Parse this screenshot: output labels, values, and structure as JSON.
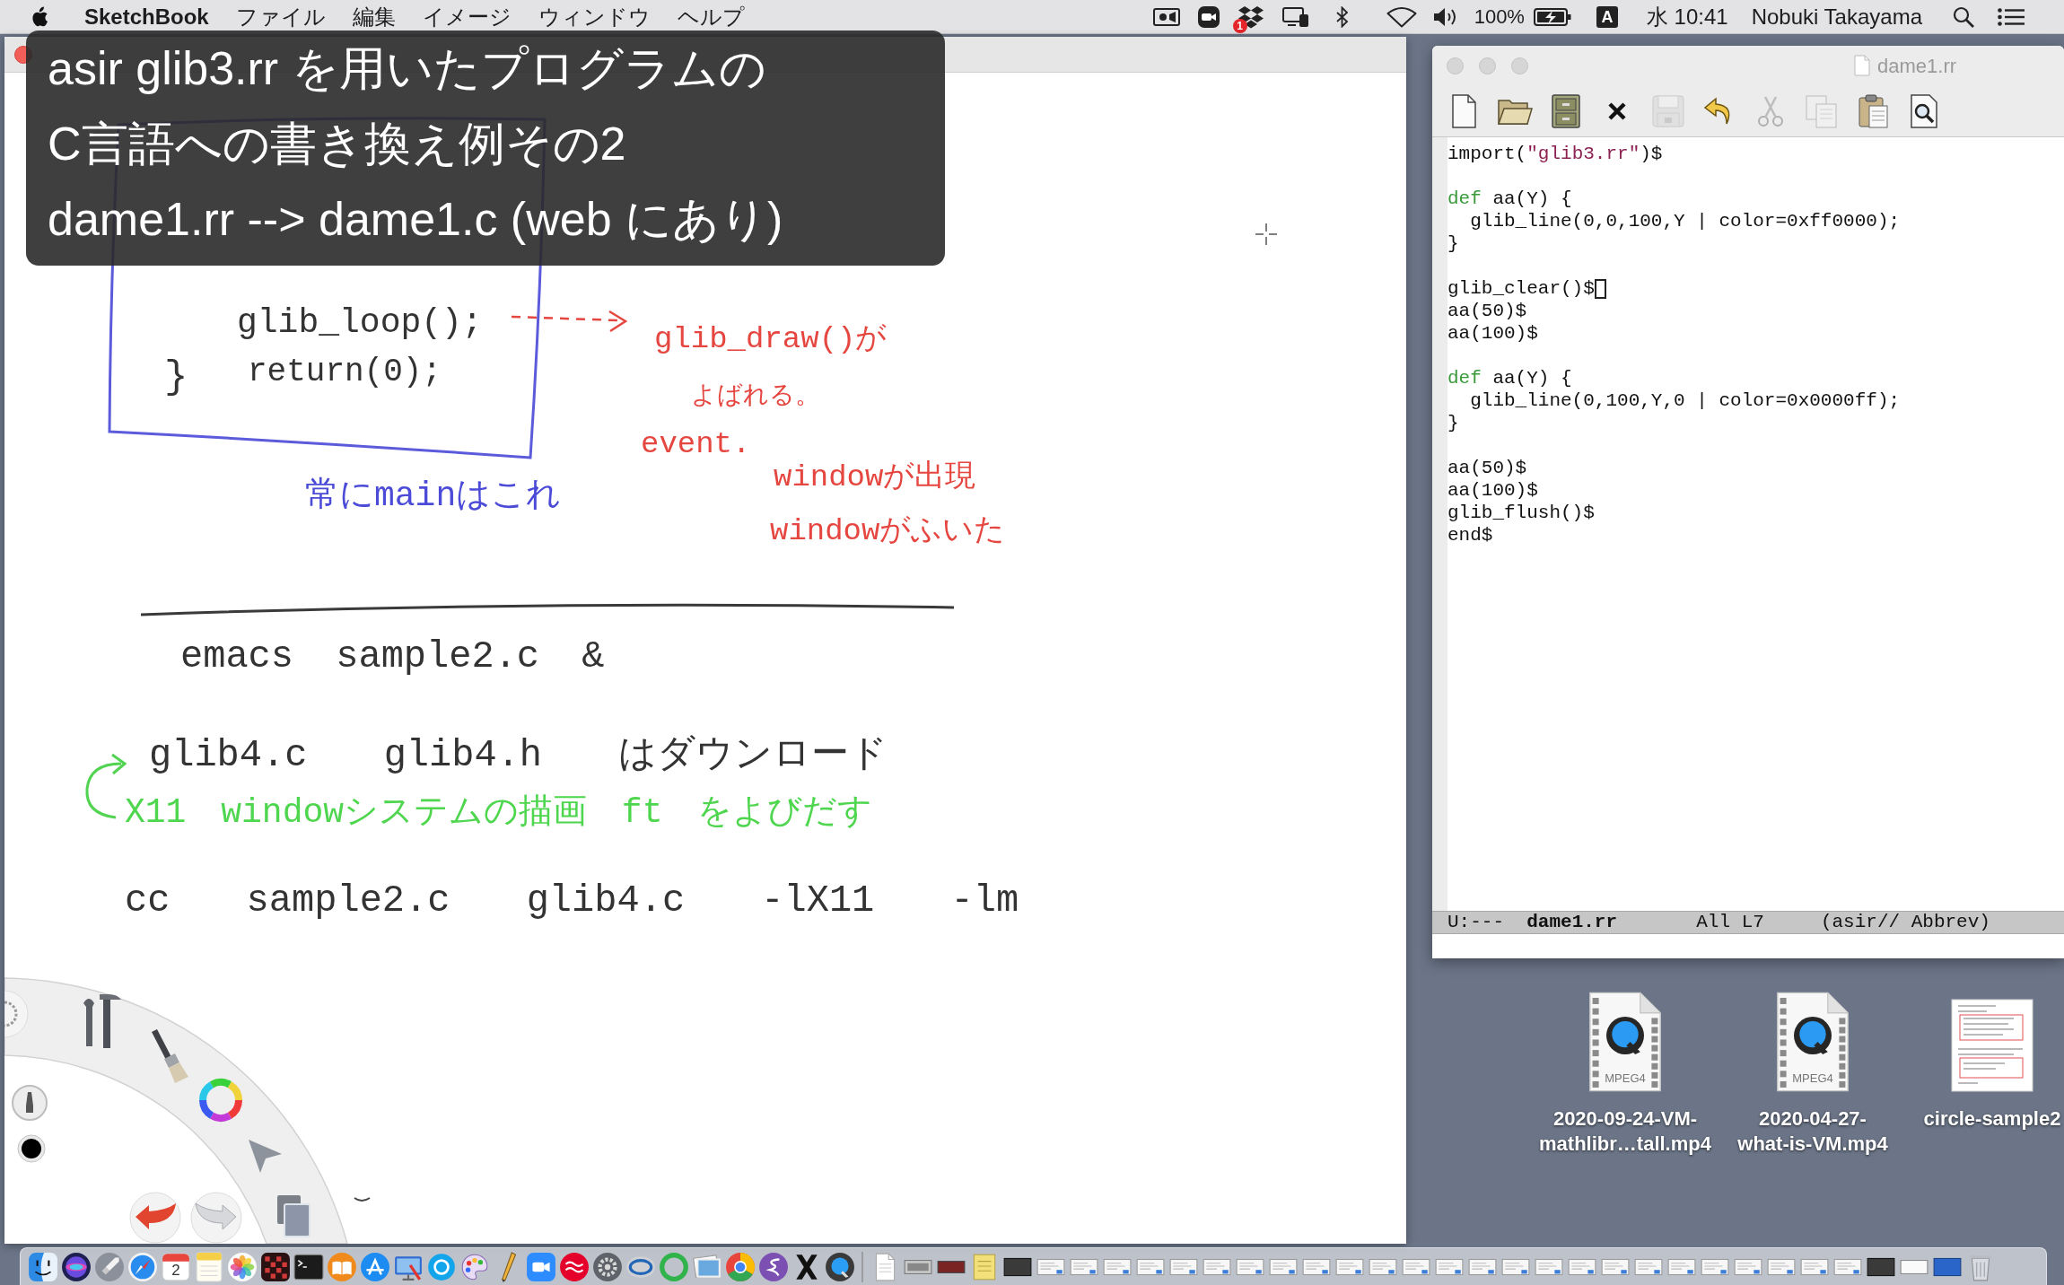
{
  "menu_bar": {
    "app_name": "SketchBook",
    "menus": [
      "ファイル",
      "編集",
      "イメージ",
      "ウィンドウ",
      "ヘルプ"
    ],
    "notification_badge": "1",
    "battery": "100%",
    "input_source": "A",
    "clock": "水 10:41",
    "user": "Nobuki Takayama"
  },
  "caption": {
    "lines": [
      "asir glib3.rr を用いたプログラムの",
      "C言語への書き換え例その2",
      "dame1.rr --> dame1.c (web にあり)"
    ]
  },
  "canvas": {
    "notes": [
      {
        "text": "glib_loop();",
        "color": "#333333"
      },
      {
        "text": "}",
        "color": "#333333"
      },
      {
        "text": "return(0);",
        "color": "#333333"
      },
      {
        "text": "glib_draw()が",
        "color": "#e5463f"
      },
      {
        "text": "よばれる。",
        "color": "#e5463f"
      },
      {
        "text": "event.",
        "color": "#e5463f"
      },
      {
        "text": "windowが出現",
        "color": "#e5463f"
      },
      {
        "text": "windowがふいた",
        "color": "#e5463f"
      },
      {
        "text": "常にmainはこれ",
        "color": "#4b4bd8"
      },
      {
        "text": "emacs sample2.c &",
        "color": "#333333"
      },
      {
        "text": "glib4.c glib4.h はダウンロード",
        "color": "#333333"
      },
      {
        "text": "X11 windowシステムの描画 ft をよびだす",
        "color": "#4fd64f"
      },
      {
        "text": "cc sample2.c glib4.c -lX11 -lm",
        "color": "#333333"
      }
    ]
  },
  "editor": {
    "title": "dame1.rr",
    "toolbar": [
      {
        "disabled": false
      },
      {
        "disabled": false
      },
      {
        "disabled": false
      },
      {
        "disabled": false
      },
      {
        "disabled": true
      },
      {
        "disabled": false
      },
      {
        "disabled": true
      },
      {
        "disabled": true
      },
      {
        "disabled": false
      },
      {
        "disabled": false
      }
    ],
    "blocks": [
      [
        {
          "tokens": [
            {
              "text": "import(",
              "kind": "plain"
            },
            {
              "text": "\"glib3.rr\"",
              "kind": "string"
            },
            {
              "text": ")$",
              "kind": "plain"
            }
          ],
          "cursor": false
        }
      ],
      [
        {
          "tokens": [
            {
              "text": "def",
              "kind": "keyword"
            },
            {
              "text": " aa(Y) {",
              "kind": "plain"
            }
          ],
          "cursor": false
        },
        {
          "tokens": [
            {
              "text": "  glib_line(0,0,100,Y | color=0xff0000);",
              "kind": "plain"
            }
          ],
          "cursor": false
        },
        {
          "tokens": [
            {
              "text": "}",
              "kind": "plain"
            }
          ],
          "cursor": false
        }
      ],
      [
        {
          "tokens": [
            {
              "text": "glib_clear()$",
              "kind": "plain"
            }
          ],
          "cursor": true
        },
        {
          "tokens": [
            {
              "text": "aa(50)$",
              "kind": "plain"
            }
          ],
          "cursor": false
        },
        {
          "tokens": [
            {
              "text": "aa(100)$",
              "kind": "plain"
            }
          ],
          "cursor": false
        }
      ],
      [
        {
          "tokens": [
            {
              "text": "def",
              "kind": "keyword"
            },
            {
              "text": " aa(Y) {",
              "kind": "plain"
            }
          ],
          "cursor": false
        },
        {
          "tokens": [
            {
              "text": "  glib_line(0,100,Y,0 | color=0x0000ff);",
              "kind": "plain"
            }
          ],
          "cursor": false
        },
        {
          "tokens": [
            {
              "text": "}",
              "kind": "plain"
            }
          ],
          "cursor": false
        }
      ],
      [
        {
          "tokens": [
            {
              "text": "aa(50)$",
              "kind": "plain"
            }
          ],
          "cursor": false
        },
        {
          "tokens": [
            {
              "text": "aa(100)$",
              "kind": "plain"
            }
          ],
          "cursor": false
        },
        {
          "tokens": [
            {
              "text": "glib_flush()$",
              "kind": "plain"
            }
          ],
          "cursor": false
        },
        {
          "tokens": [
            {
              "text": "end$",
              "kind": "plain"
            }
          ],
          "cursor": false
        }
      ]
    ],
    "mode_line": "U:---  **dame1.rr**       All L7     (asir// Abbrev)"
  },
  "desktop_icons": [
    {
      "kind": "video",
      "badge": "MPEG4",
      "label": "2020-09-24-VM-\nmathlibr…tall.mp4"
    },
    {
      "kind": "video",
      "badge": "MPEG4",
      "label": "2020-04-27-\nwhat-is-VM.mp4"
    },
    {
      "kind": "document",
      "label": "circle-sample2"
    }
  ],
  "dock": {
    "calendar_day": "2"
  }
}
